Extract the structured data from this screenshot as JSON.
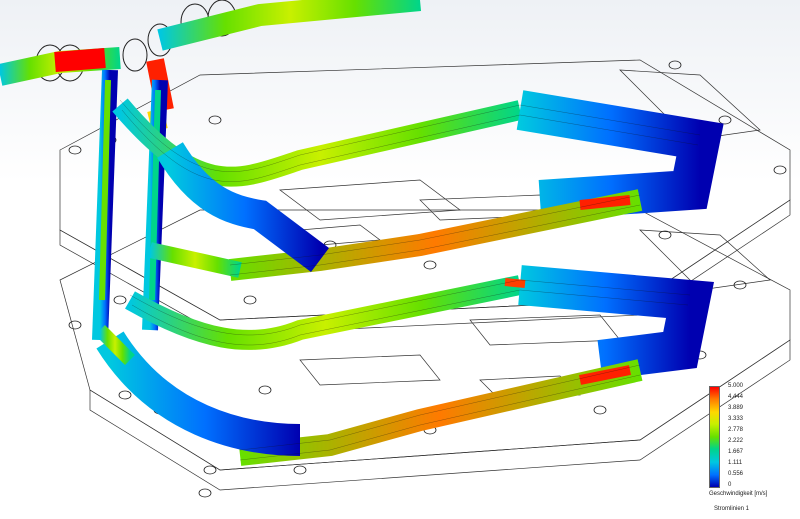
{
  "scene": {
    "model": "cooling-plate-flow-simulation",
    "result_type": "streamlines",
    "background_top": "#eef1f5",
    "background_bottom": "#ffffff"
  },
  "legend": {
    "ticks": [
      "5.000",
      "4.444",
      "3.889",
      "3.333",
      "2.778",
      "2.222",
      "1.667",
      "1.111",
      "0.556",
      "0"
    ],
    "unit_label": "Geschwindigkeit [m/s]",
    "study_label": "Stromlinien 1",
    "gradient": [
      "#ff0000",
      "#ff7a00",
      "#ffd800",
      "#c8f000",
      "#66e000",
      "#00d58a",
      "#00c8e0",
      "#0070ff",
      "#0000b0"
    ]
  }
}
